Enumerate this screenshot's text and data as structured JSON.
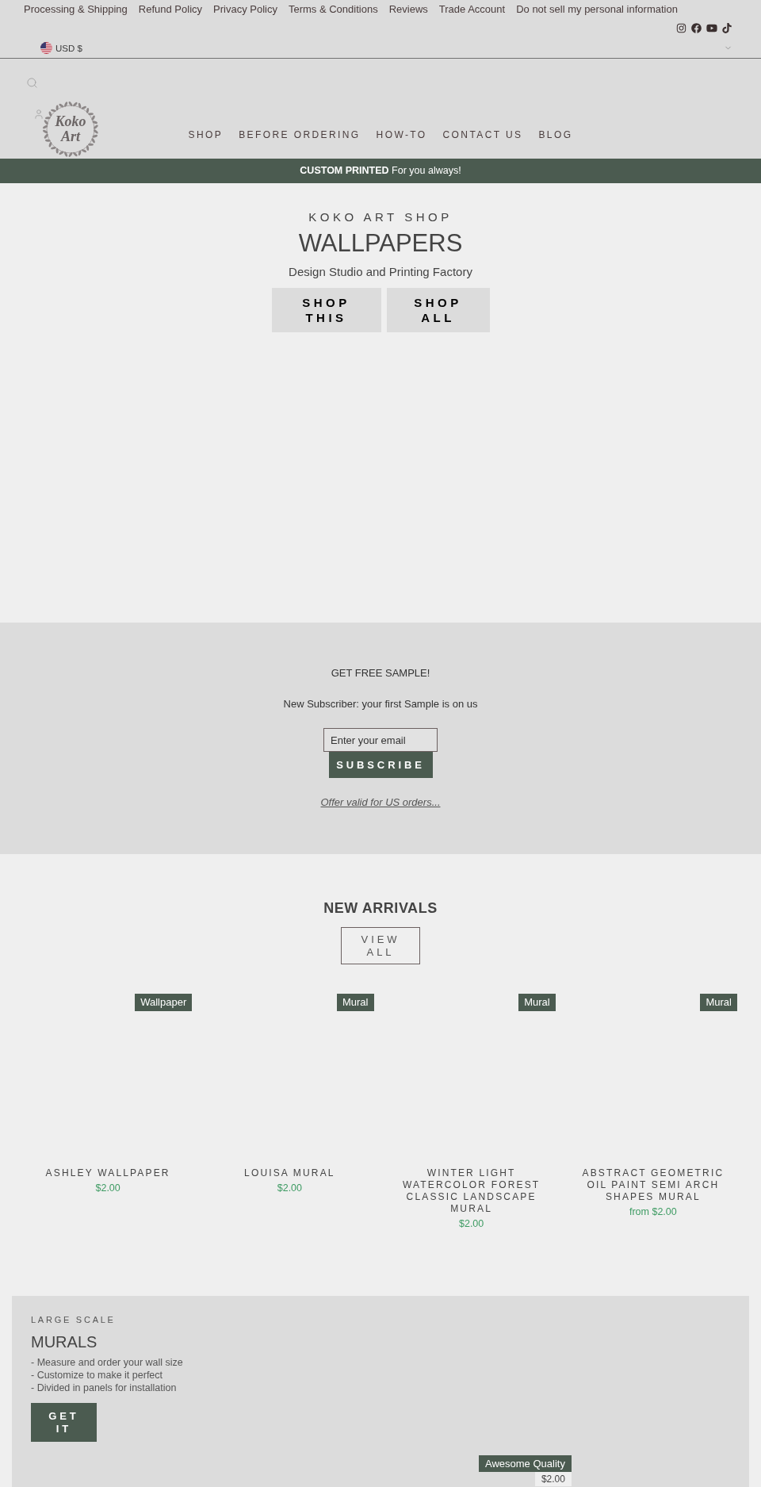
{
  "top_bar": {
    "links": [
      "Processing & Shipping",
      "Refund Policy",
      "Privacy Policy",
      "Terms & Conditions",
      "Reviews",
      "Trade Account",
      "Do not sell my personal information"
    ],
    "currency": "USD $"
  },
  "header": {
    "logo": {
      "text": "Koko Art"
    },
    "nav": [
      "SHOP",
      "BEFORE ORDERING",
      "HOW-TO",
      "CONTACT US",
      "BLOG"
    ]
  },
  "announcement": {
    "text": "**CUSTOM PRINTED** For you always!"
  },
  "hero": {
    "kicker": "KOKO ART SHOP",
    "title": "WALLPAPERS",
    "subtitle": "Design Studio and Printing Factory",
    "buttons": [
      {
        "label": "SHOP THIS"
      },
      {
        "label": "SHOP ALL"
      }
    ]
  },
  "newsletter": {
    "title": "GET FREE SAMPLE!",
    "text": "New Subscriber: your first Sample is on us",
    "email": {
      "placeholder": "Enter your email"
    },
    "button": "SUBSCRIBE",
    "link": "Offer valid for US orders..."
  },
  "new_arrivals": {
    "title": "NEW ARRIVALS",
    "button": "VIEW ALL",
    "products": [
      {
        "tag": "Wallpaper",
        "name": "ASHLEY WALLPAPER",
        "price": "$2.00"
      },
      {
        "tag": "Mural",
        "name": "LOUISA MURAL",
        "price": "$2.00"
      },
      {
        "tag": "Mural",
        "name": "WINTER LIGHT WATERCOLOR FOREST CLASSIC LANDSCAPE MURAL",
        "price": "$2.00"
      },
      {
        "tag": "Mural",
        "name": "ABSTRACT GEOMETRIC OIL PAINT SEMI ARCH SHAPES MURAL",
        "price": "from $2.00"
      }
    ]
  },
  "murals": {
    "kicker": "LARGE SCALE",
    "title": "MURALS",
    "bullets": [
      "- Measure and order your wall size",
      "- Customize to make it perfect",
      "- Divided in panels for installation"
    ],
    "button": "GET IT",
    "product": {
      "tag": "Awesome Quality",
      "price": "$2.00"
    }
  }
}
